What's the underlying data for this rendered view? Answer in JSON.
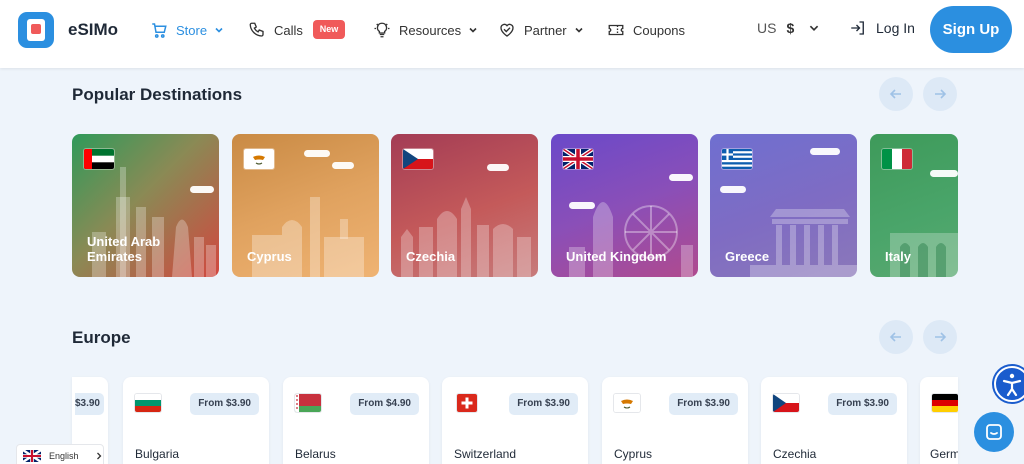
{
  "header": {
    "brand": "eSIMo",
    "nav": {
      "store": "Store",
      "calls": "Calls",
      "calls_badge": "New",
      "resources": "Resources",
      "partner": "Partner",
      "coupons": "Coupons"
    },
    "currency_code": "US",
    "currency_symbol": "$",
    "login": "Log In",
    "signup": "Sign Up"
  },
  "popular": {
    "title": "Popular Destinations",
    "destinations": [
      {
        "name": "United Arab Emirates",
        "flag": "ae"
      },
      {
        "name": "Cyprus",
        "flag": "cy"
      },
      {
        "name": "Czechia",
        "flag": "cz"
      },
      {
        "name": "United Kingdom",
        "flag": "gb"
      },
      {
        "name": "Greece",
        "flag": "gr"
      },
      {
        "name": "Italy",
        "flag": "it"
      }
    ]
  },
  "europe": {
    "title": "Europe",
    "partial_price": "$3.90",
    "cards": [
      {
        "country": "Bulgaria",
        "price": "From $3.90",
        "flag": "bg"
      },
      {
        "country": "Belarus",
        "price": "From $4.90",
        "flag": "by"
      },
      {
        "country": "Switzerland",
        "price": "From $3.90",
        "flag": "ch"
      },
      {
        "country": "Cyprus",
        "price": "From $3.90",
        "flag": "cy"
      },
      {
        "country": "Czechia",
        "price": "From $3.90",
        "flag": "cz"
      },
      {
        "country": "Germany",
        "price": "",
        "flag": "de"
      }
    ]
  },
  "language_selector": {
    "label": "English"
  },
  "colors": {
    "accent": "#2b8fe0",
    "badge": "#f05a5a",
    "page_bg": "#eef4fb"
  }
}
